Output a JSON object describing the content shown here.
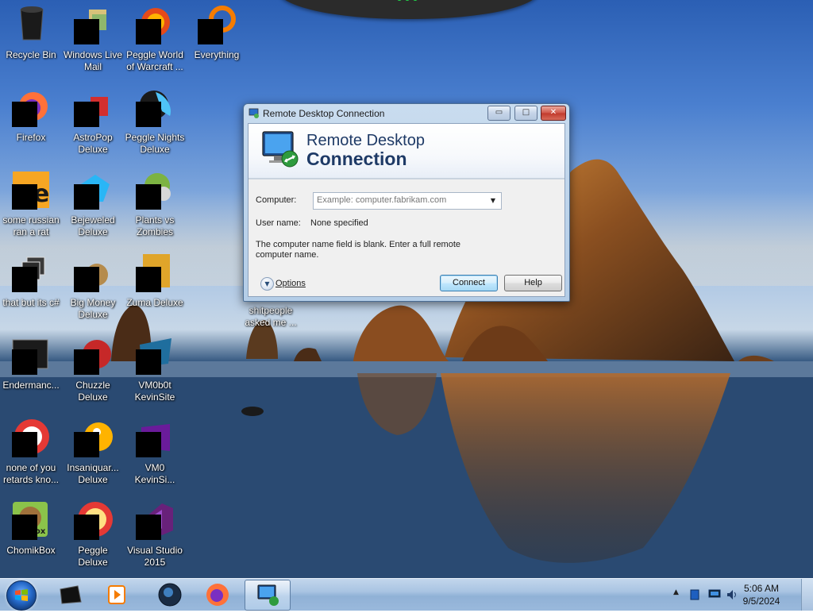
{
  "desktop_icons": [
    {
      "label": "Recycle Bin"
    },
    {
      "label": "Windows Live Mail"
    },
    {
      "label": "Peggle World of Warcraft ..."
    },
    {
      "label": "Everything"
    },
    {
      "label": "Firefox"
    },
    {
      "label": "AstroPop Deluxe"
    },
    {
      "label": "Peggle Nights Deluxe"
    },
    {
      "label": "some russian ran a rat"
    },
    {
      "label": "Bejeweled Deluxe"
    },
    {
      "label": "Plants vs Zombies"
    },
    {
      "label": "that but its c#"
    },
    {
      "label": "Big Money Deluxe"
    },
    {
      "label": "Zuma Deluxe"
    },
    {
      "label": "shitpeople asked me ..."
    },
    {
      "label": "Endermanc..."
    },
    {
      "label": "Chuzzle Deluxe"
    },
    {
      "label": "VM0b0t KevinSite"
    },
    {
      "label": "none of you retards kno..."
    },
    {
      "label": "Insaniquar... Deluxe"
    },
    {
      "label": "VM0 KevinSi..."
    },
    {
      "label": "ChomikBox"
    },
    {
      "label": "Peggle Deluxe"
    },
    {
      "label": "Visual Studio 2015"
    }
  ],
  "dialog": {
    "title": "Remote Desktop Connection",
    "window_buttons": {
      "minimize": "▭",
      "maximize": "□",
      "close": "✕"
    },
    "banner_line1": "Remote Desktop",
    "banner_line2": "Connection",
    "computer_label": "Computer:",
    "computer_value": "",
    "computer_placeholder": "Example: computer.fabrikam.com",
    "username_label": "User name:",
    "username_value": "None specified",
    "message": "The computer name field is blank. Enter a full remote computer name.",
    "options_label": "Options",
    "connect_label": "Connect",
    "help_label": "Help"
  },
  "taskbar": {
    "clock_time": "5:06 AM",
    "clock_date": "9/5/2024",
    "tray_arrow": "▲",
    "pinned": [
      "file-manager",
      "media-player",
      "app-globe",
      "firefox",
      "remote-desktop"
    ],
    "active": "remote-desktop"
  },
  "colors": {
    "dialog_title_text": "#1e3a66",
    "taskbar": "#a9c4e2"
  }
}
